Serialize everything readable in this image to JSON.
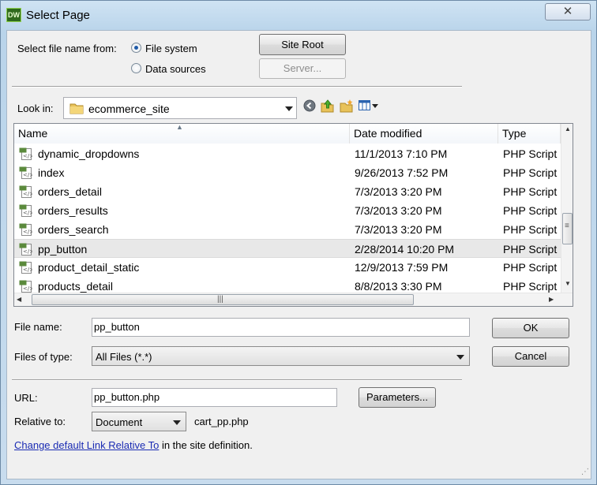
{
  "window": {
    "title": "Select Page",
    "app_icon_text": "DW",
    "close_glyph": "✕"
  },
  "select_from": {
    "label": "Select file name from:",
    "options": [
      {
        "label": "File system",
        "selected": true
      },
      {
        "label": "Data sources",
        "selected": false
      }
    ],
    "site_root_button": "Site Root",
    "server_button": "Server..."
  },
  "look_in": {
    "label": "Look in:",
    "value": "ecommerce_site"
  },
  "columns": {
    "name": "Name",
    "date": "Date modified",
    "type": "Type"
  },
  "files": [
    {
      "name": "dynamic_dropdowns",
      "date": "11/1/2013 7:10 PM",
      "type": "PHP Script",
      "selected": false
    },
    {
      "name": "index",
      "date": "9/26/2013 7:52 PM",
      "type": "PHP Script",
      "selected": false
    },
    {
      "name": "orders_detail",
      "date": "7/3/2013 3:20 PM",
      "type": "PHP Script",
      "selected": false
    },
    {
      "name": "orders_results",
      "date": "7/3/2013 3:20 PM",
      "type": "PHP Script",
      "selected": false
    },
    {
      "name": "orders_search",
      "date": "7/3/2013 3:20 PM",
      "type": "PHP Script",
      "selected": false
    },
    {
      "name": "pp_button",
      "date": "2/28/2014 10:20 PM",
      "type": "PHP Script",
      "selected": true
    },
    {
      "name": "product_detail_static",
      "date": "12/9/2013 7:59 PM",
      "type": "PHP Script",
      "selected": false
    },
    {
      "name": "products_detail",
      "date": "8/8/2013 3:30 PM",
      "type": "PHP Script",
      "selected": false
    }
  ],
  "file_name": {
    "label": "File name:",
    "value": "pp_button"
  },
  "files_of_type": {
    "label": "Files of type:",
    "value": "All Files (*.*)"
  },
  "ok_button": "OK",
  "cancel_button": "Cancel",
  "url": {
    "label": "URL:",
    "value": "pp_button.php"
  },
  "parameters_button": "Parameters...",
  "relative_to": {
    "label": "Relative to:",
    "value": "Document",
    "file": "cart_pp.php"
  },
  "footer": {
    "link_text": "Change default Link Relative To",
    "rest_text": " in the site definition."
  }
}
